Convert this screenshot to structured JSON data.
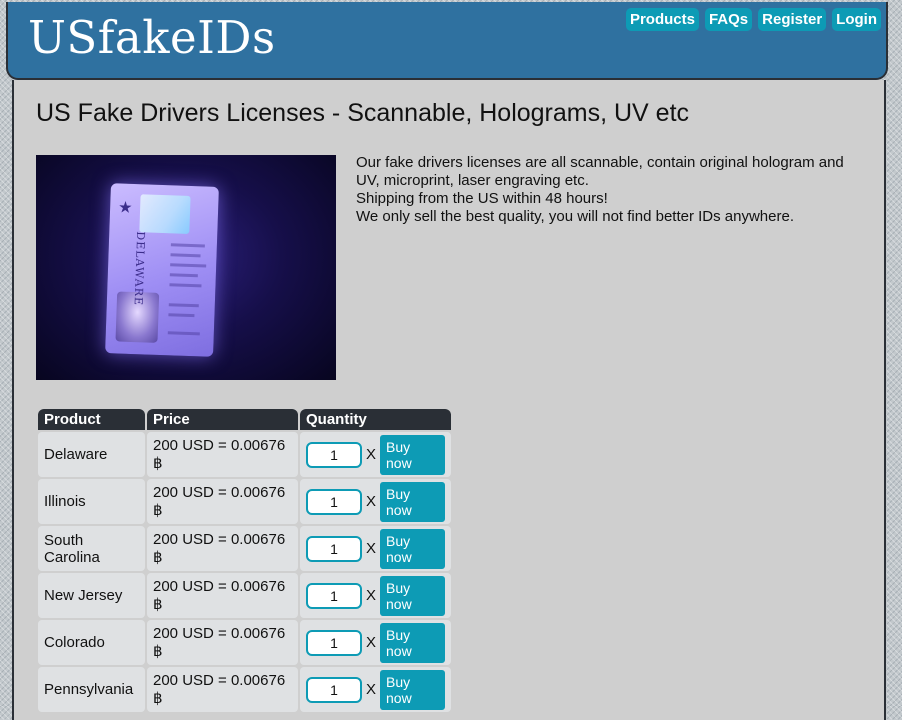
{
  "header": {
    "logo_text": "USfakeIDs",
    "nav": [
      "Products",
      "FAQs",
      "Register",
      "Login"
    ]
  },
  "main": {
    "title": "US Fake Drivers Licenses - Scannable, Holograms, UV etc",
    "image": {
      "alt_state_text": "DELAWARE",
      "icon": "id-card-uv-photo"
    },
    "description": [
      "Our fake drivers licenses are all scannable, contain original hologram and UV, microprint, laser engraving etc.",
      "Shipping from the US within 48 hours!",
      "We only sell the best quality, you will not find better IDs anywhere."
    ]
  },
  "table": {
    "headers": [
      "Product",
      "Price",
      "Quantity"
    ],
    "times_symbol": "X",
    "buy_label": "Buy now",
    "rows": [
      {
        "product": "Delaware",
        "price": "200 USD = 0.00676 ฿",
        "qty": "1"
      },
      {
        "product": "Illinois",
        "price": "200 USD = 0.00676 ฿",
        "qty": "1"
      },
      {
        "product": "South Carolina",
        "price": "200 USD = 0.00676 ฿",
        "qty": "1"
      },
      {
        "product": "New Jersey",
        "price": "200 USD = 0.00676 ฿",
        "qty": "1"
      },
      {
        "product": "Colorado",
        "price": "200 USD = 0.00676 ฿",
        "qty": "1"
      },
      {
        "product": "Pennsylvania",
        "price": "200 USD = 0.00676 ฿",
        "qty": "1"
      }
    ]
  },
  "colors": {
    "header_bg": "#2f71a0",
    "accent": "#0d9bb5",
    "dark": "#2a2f36",
    "content_bg": "#cfcfcf"
  }
}
